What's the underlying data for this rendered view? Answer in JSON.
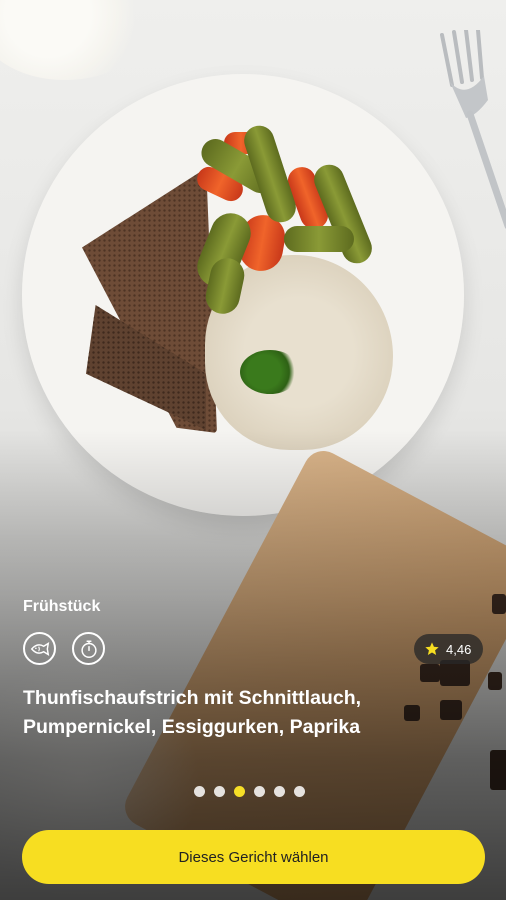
{
  "recipe": {
    "category": "Frühstück",
    "title": "Thunfischaufstrich mit Schnittlauch, Pumpernickel, Essiggurken, Paprika",
    "rating": "4,46",
    "diet_icons": [
      {
        "name": "fish-icon"
      },
      {
        "name": "stopwatch-icon"
      }
    ]
  },
  "carousel": {
    "count": 6,
    "active_index": 2
  },
  "cta": {
    "label": "Dieses Gericht wählen"
  },
  "colors": {
    "accent": "#f7de21",
    "rating_bg": "#2a2a2a",
    "star": "#f7de21"
  }
}
